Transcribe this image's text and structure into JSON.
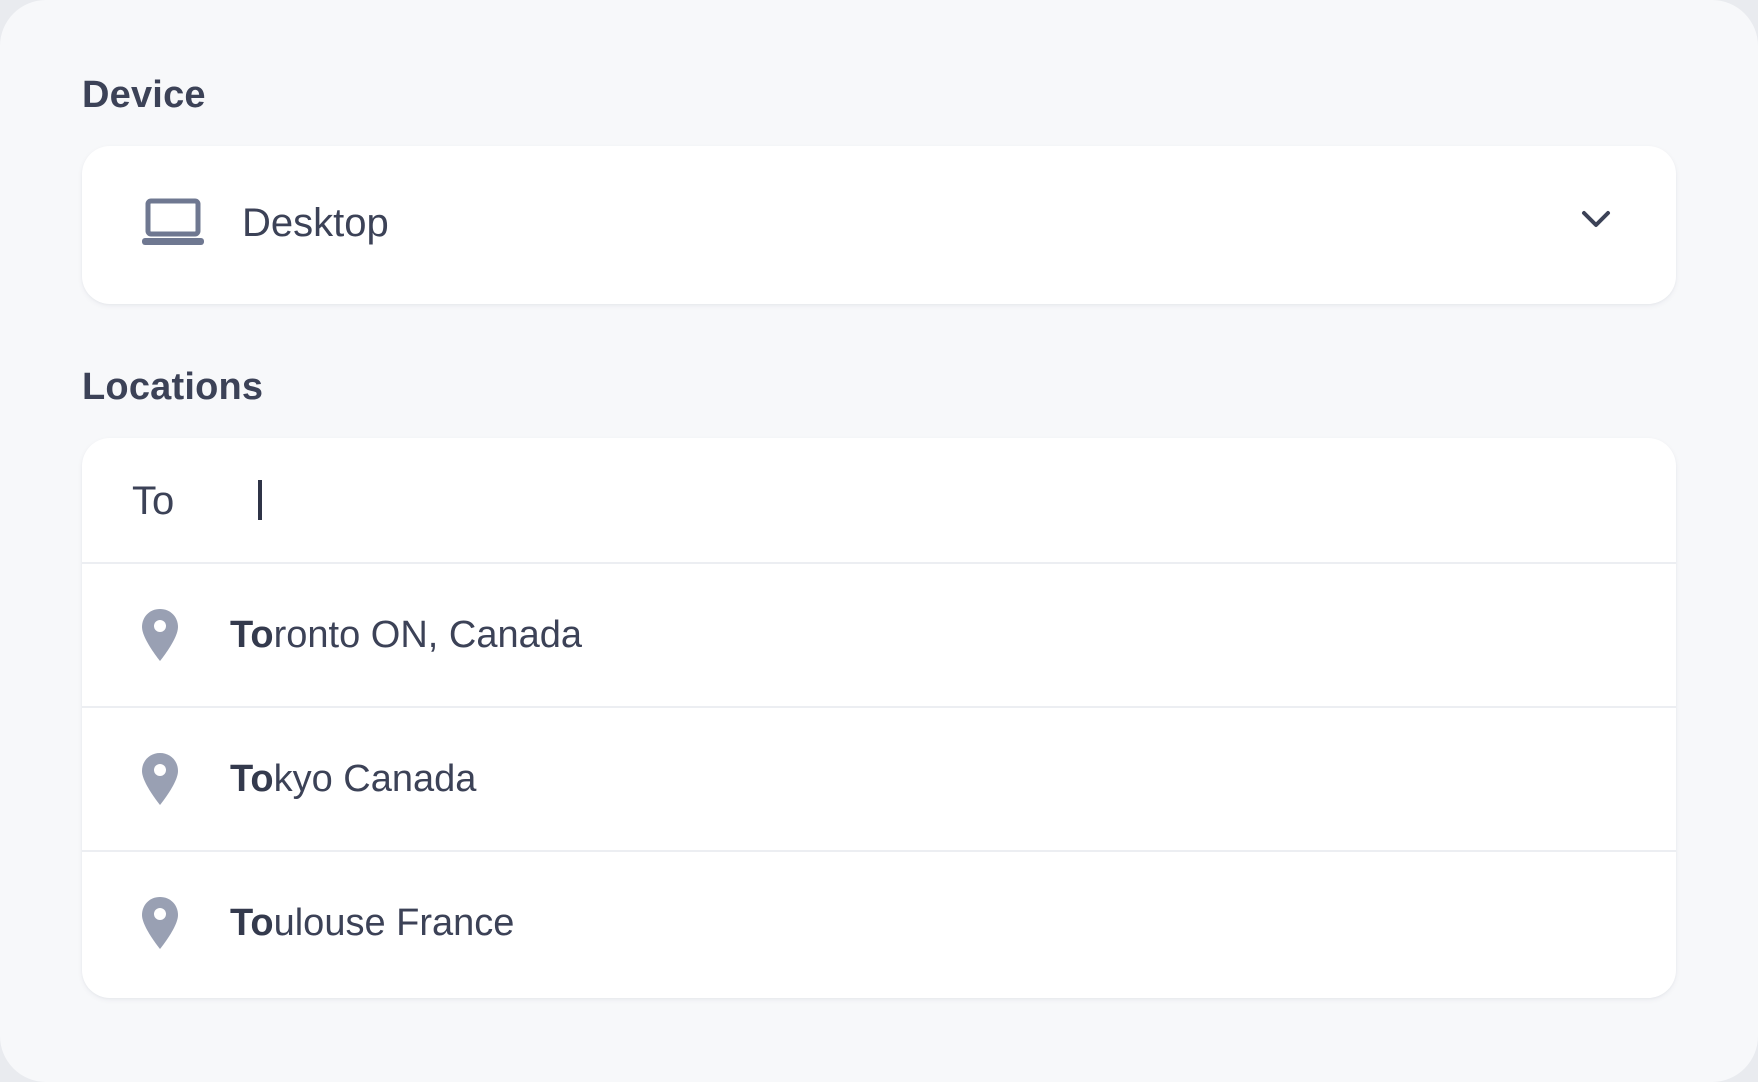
{
  "device": {
    "label": "Device",
    "selected": "Desktop",
    "icon": "laptop-icon"
  },
  "locations": {
    "label": "Locations",
    "query": "To",
    "results": [
      {
        "match": "To",
        "rest": "ronto ON, Canada",
        "icon": "map-pin-icon"
      },
      {
        "match": "To",
        "rest": "kyo Canada",
        "icon": "map-pin-icon"
      },
      {
        "match": "To",
        "rest": "ulouse France",
        "icon": "map-pin-icon"
      }
    ]
  },
  "colors": {
    "background": "#f7f8fa",
    "card": "#ffffff",
    "text": "#3c4257",
    "icon": "#99a0b3",
    "divider": "#eceef2"
  }
}
